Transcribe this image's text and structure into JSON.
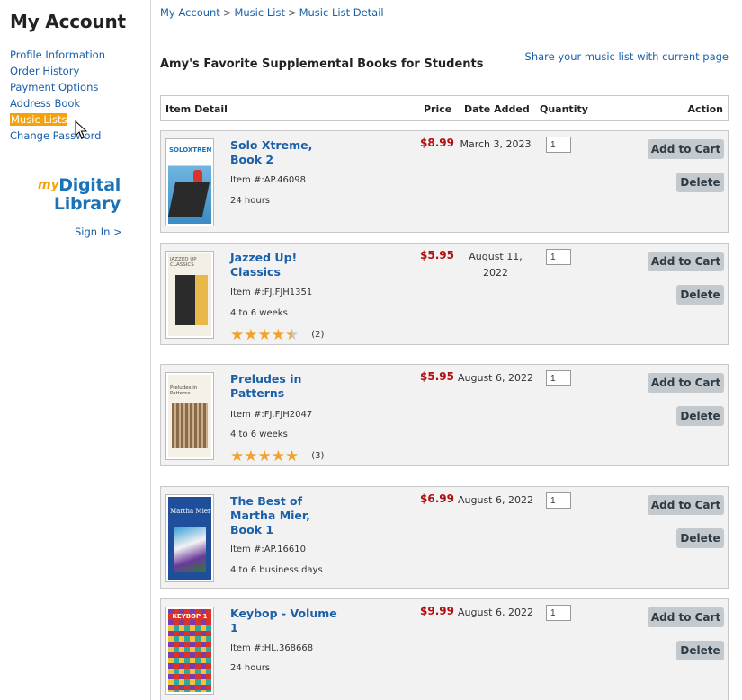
{
  "sidebar": {
    "title": "My Account",
    "items": [
      {
        "label": "Profile Information"
      },
      {
        "label": "Order History"
      },
      {
        "label": "Payment Options"
      },
      {
        "label": "Address Book"
      },
      {
        "label": "Music Lists",
        "active": true
      },
      {
        "label": "Change Password"
      }
    ],
    "logo": {
      "my": "my",
      "line1": "Digital",
      "line2": "Library"
    },
    "sign_in": "Sign In >"
  },
  "breadcrumb": {
    "items": [
      "My Account",
      "Music List",
      "Music List Detail"
    ],
    "separator": ">"
  },
  "list_title": "Amy's Favorite Supplemental Books for Students",
  "share_link": "Share your music list with current page",
  "table": {
    "headers": {
      "item_detail": "Item Detail",
      "price": "Price",
      "date_added": "Date Added",
      "quantity": "Quantity",
      "action": "Action"
    },
    "rows": [
      {
        "name": "Solo Xtreme, Book 2",
        "item_no": "Item #:AP.46098",
        "shipping": "24 hours",
        "price": "$8.99",
        "date": "March 3, 2023",
        "quantity": "1",
        "add_to_cart": "Add to Cart",
        "delete": "Delete",
        "cover_title": "SOLOXTREME",
        "cover_color": "#4aa6d8"
      },
      {
        "name": "Jazzed Up! Classics",
        "item_no": "Item #:FJ.FJH1351",
        "shipping": "4 to 6 weeks",
        "rating_stars": 4.5,
        "rating_count": "(2)",
        "price": "$5.95",
        "date": "August 11, 2022",
        "quantity": "1",
        "add_to_cart": "Add to Cart",
        "delete": "Delete",
        "cover_title": "JAZZED UP CLASSICS",
        "cover_color": "#e8b84a"
      },
      {
        "name": "Preludes in Patterns",
        "item_no": "Item #:FJ.FJH2047",
        "shipping": "4 to 6 weeks",
        "rating_stars": 5,
        "rating_count": "(3)",
        "price": "$5.95",
        "date": "August 6, 2022",
        "quantity": "1",
        "add_to_cart": "Add to Cart",
        "delete": "Delete",
        "cover_title": "Preludes in Patterns",
        "cover_color": "#8a6a4a"
      },
      {
        "name": "The Best of Martha Mier, Book 1",
        "item_no": "Item #:AP.16610",
        "shipping": "4 to 6 business days",
        "price": "$6.99",
        "date": "August 6, 2022",
        "quantity": "1",
        "add_to_cart": "Add to Cart",
        "delete": "Delete",
        "cover_title": "Martha Mier",
        "cover_color": "#1f4f9a"
      },
      {
        "name": "Keybop - Volume 1",
        "item_no": "Item #:HL.368668",
        "shipping": "24 hours",
        "price": "$9.99",
        "date": "August 6, 2022",
        "quantity": "1",
        "add_to_cart": "Add to Cart",
        "delete": "Delete",
        "cover_title": "KEYBOP 1",
        "cover_color": "#d8342a"
      }
    ]
  },
  "colors": {
    "link": "#1a5fa8",
    "price": "#b01010",
    "active_nav": "#f5a20a",
    "star": "#f2a22a",
    "button": "#c3c9cd",
    "row_bg": "#f2f2f2"
  }
}
